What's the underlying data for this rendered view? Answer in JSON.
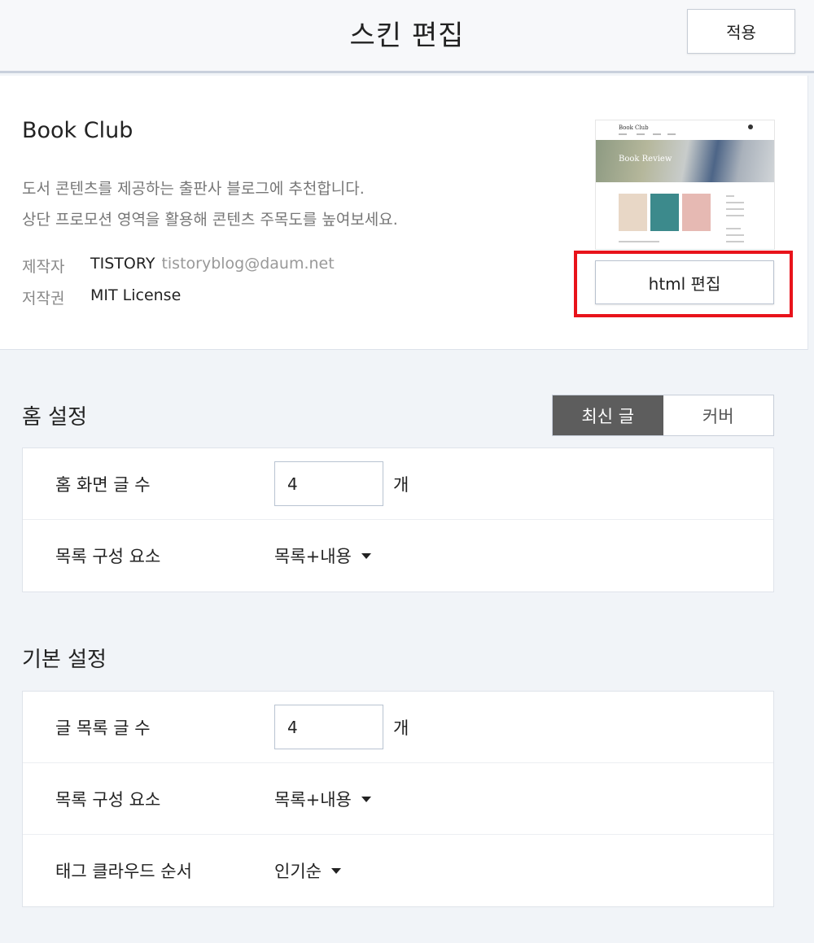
{
  "header": {
    "title": "스킨 편집",
    "apply_label": "적용"
  },
  "skin": {
    "name": "Book Club",
    "desc_line1": "도서 콘텐츠를 제공하는 출판사 블로그에 추천합니다.",
    "desc_line2": "상단 프로모션 영역을 활용해 콘텐츠 주목도를 높여보세요.",
    "author_label": "제작자",
    "author": "TISTORY",
    "author_email": "tistoryblog@daum.net",
    "license_label": "저작권",
    "license": "MIT License",
    "html_edit_label": "html 편집",
    "thumbnail": {
      "logo": "Book Club",
      "hero_text": "Book Review",
      "card_colors": [
        "#e8d7c6",
        "#3c8a8c",
        "#e6b9b3"
      ]
    }
  },
  "home_settings": {
    "title": "홈 설정",
    "tabs": [
      {
        "label": "최신 글",
        "active": true
      },
      {
        "label": "커버",
        "active": false
      }
    ],
    "rows": {
      "post_count": {
        "label": "홈 화면 글 수",
        "value": "4",
        "unit": "개"
      },
      "list_elements": {
        "label": "목록 구성 요소",
        "value": "목록+내용"
      }
    }
  },
  "basic_settings": {
    "title": "기본 설정",
    "rows": {
      "post_count": {
        "label": "글 목록 글 수",
        "value": "4",
        "unit": "개"
      },
      "list_elements": {
        "label": "목록 구성 요소",
        "value": "목록+내용"
      },
      "tag_cloud_order": {
        "label": "태그 클라우드 순서",
        "value": "인기순"
      }
    }
  },
  "colors": {
    "highlight": "#e8131b",
    "active_tab": "#5d5d5d",
    "page_bg": "#f1f4f8"
  }
}
